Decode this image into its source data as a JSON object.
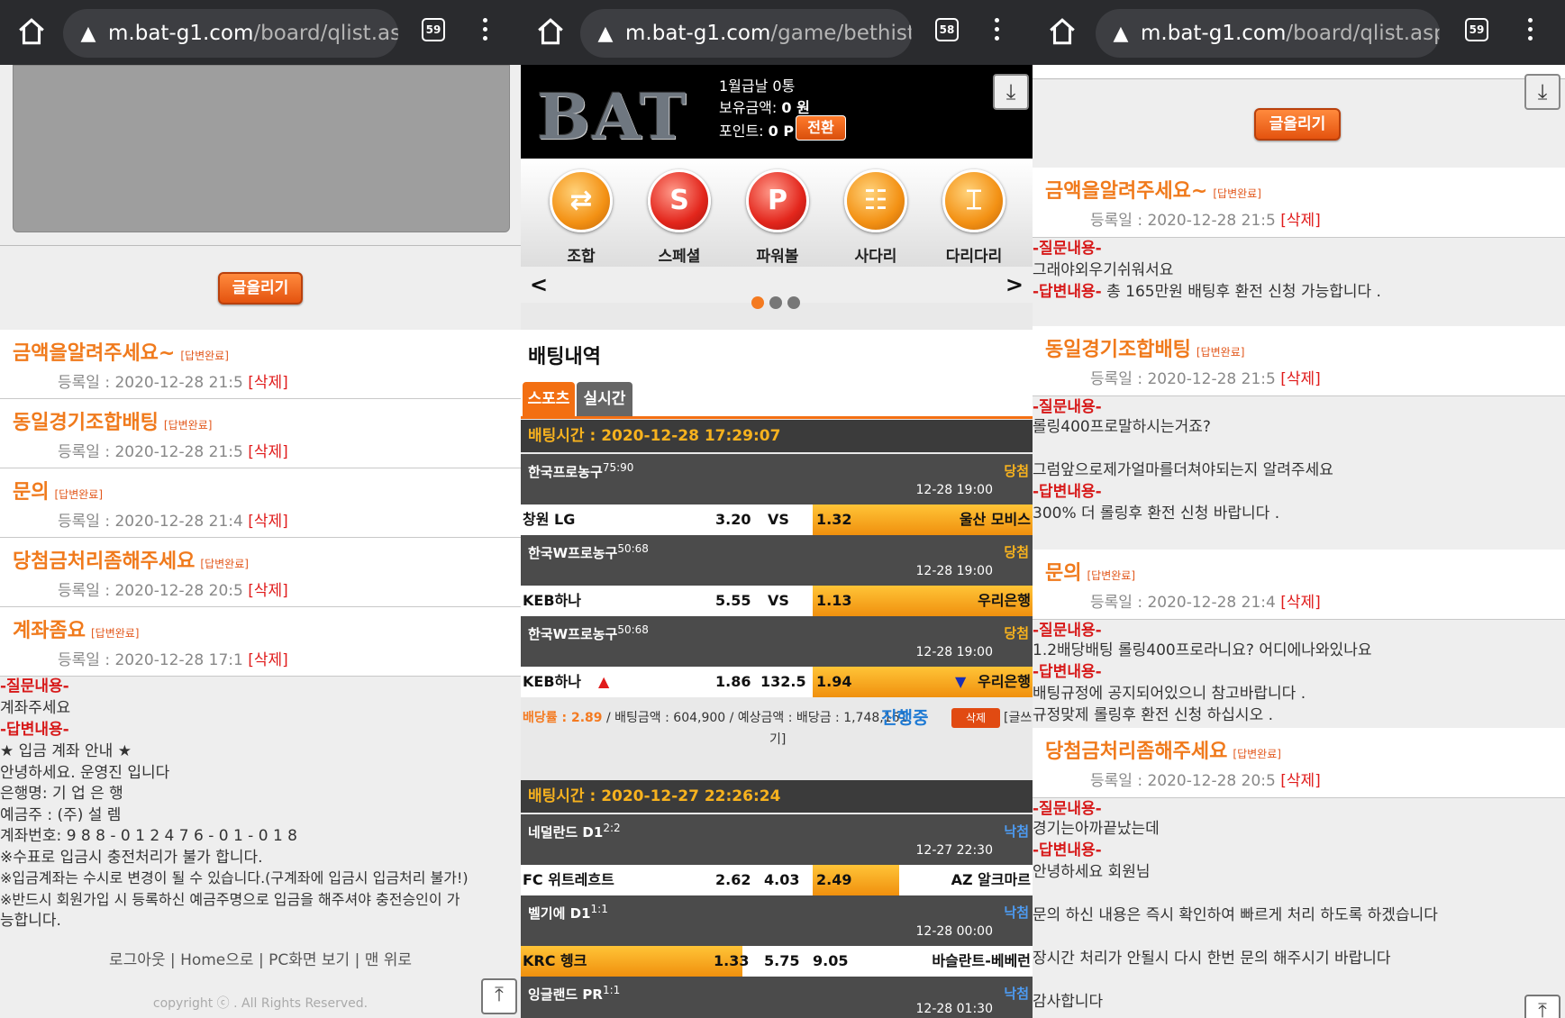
{
  "panel1": {
    "url_domain": "m.bat-g1.com",
    "url_path": "/board/qlist.asp",
    "tab_count": "59",
    "write_button": "글올리기",
    "items": [
      {
        "title": "금액을알려주세요~",
        "badge": "[답변완료]",
        "date": "등록일 : 2020-12-28 21:5",
        "del": "[삭제]"
      },
      {
        "title": "동일경기조합배팅",
        "badge": "[답변완료]",
        "date": "등록일 : 2020-12-28 21:5",
        "del": "[삭제]"
      },
      {
        "title": "문의",
        "badge": "[답변완료]",
        "date": "등록일 : 2020-12-28 21:4",
        "del": "[삭제]"
      },
      {
        "title": "당첨금처리좀해주세요",
        "badge": "[답변완료]",
        "date": "등록일 : 2020-12-28 20:5",
        "del": "[삭제]"
      },
      {
        "title": "계좌좀요",
        "badge": "[답변완료]",
        "date": "등록일 : 2020-12-28 17:1",
        "del": "[삭제]"
      }
    ],
    "q_label": "-질문내용-",
    "q_text": "계좌주세요",
    "a_label": "-답변내용-",
    "a_lines": [
      "★ 입금 계좌 안내 ★",
      "안녕하세요. 운영진 입니다",
      "은행명:   기 업 은 행",
      "예금주 :  (주) 설 렘",
      "계좌번호: 9 8 8 - 0 1 2 4 7 6 - 0 1 - 0 1 8",
      "※수표로 입금시 충전처리가 불가 합니다.",
      "※입금계좌는 수시로 변경이 될 수 있습니다.(구계좌에 입금시 입금처리 불가!)",
      "※반드시 회원가입 시 등록하신 예금주명으로 입금을 해주셔야 충전승인이 가",
      "능합니다."
    ],
    "footer_links": "로그아웃 | Home으로 | PC화면 보기 | 맨 위로",
    "copyright": "copyright ⓒ . All Rights Reserved."
  },
  "panel2": {
    "url_domain": "m.bat-g1.com",
    "url_path": "/game/bethistor",
    "tab_count": "58",
    "logo": "BAT",
    "info_line1": "1월급날 0통",
    "info_line2_label": "보유금액:",
    "info_line2_value": "0 원",
    "info_line3_label": "포인트:",
    "info_line3_value": "0 P",
    "convert_button": "전환",
    "games": [
      "조합",
      "스페셜",
      "파워볼",
      "사다리",
      "다리다리"
    ],
    "game_icons": [
      "shuffle-icon",
      "S",
      "P",
      "ladder-icon",
      "bridge-icon"
    ],
    "section_title": "배팅내역",
    "tab_sports": "스포츠",
    "tab_live": "실시간",
    "bet1": {
      "time": "배팅시간 : 2020-12-28 17:29:07",
      "matches": [
        {
          "league": "한국프로농구",
          "score": "75:90",
          "result": "당첨",
          "time": "12-28 19:00",
          "home": "창원 LG",
          "h_odds": "3.20",
          "mid": "VS",
          "a_odds": "1.32",
          "away": "울산 모비스"
        },
        {
          "league": "한국W프로농구",
          "score": "50:68",
          "result": "당첨",
          "time": "12-28 19:00",
          "home": "KEB하나",
          "h_odds": "5.55",
          "mid": "VS",
          "a_odds": "1.13",
          "away": "우리은행"
        },
        {
          "league": "한국W프로농구",
          "score": "50:68",
          "result": "당첨",
          "time": "12-28 19:00",
          "home": "KEB하나",
          "h_odds": "1.86",
          "mid": "132.5",
          "a_odds": "1.94",
          "away": "우리은행"
        }
      ],
      "summary_rate": "배당률 : 2.89",
      "summary_rest": " / 배팅금액 : 604,900 / 예상금액 : 배당금 : 1,748,161",
      "summary_tail": "기]",
      "status": "진행중",
      "delete": "삭제",
      "trail": "[글쓰"
    },
    "bet2": {
      "time": "배팅시간 : 2020-12-27 22:26:24",
      "matches": [
        {
          "league": "네덜란드 D1",
          "score": "2:2",
          "result": "낙첨",
          "time": "12-27 22:30",
          "home": "FC 위트레흐트",
          "h_odds": "2.62",
          "mid": "4.03",
          "a_odds": "2.49",
          "away": "AZ 알크마르"
        },
        {
          "league": "벨기에 D1",
          "score": "1:1",
          "result": "낙첨",
          "time": "12-28 00:00",
          "home": "KRC 헹크",
          "h_odds": "1.33",
          "mid": "5.75",
          "a_odds": "9.05",
          "away": "바슬란트-베베런"
        },
        {
          "league": "잉글랜드 PR",
          "score": "1:1",
          "result": "낙첨",
          "time": "12-28 01:30"
        }
      ]
    }
  },
  "panel3": {
    "url_domain": "m.bat-g1.com",
    "url_path": "/board/qlist.asp",
    "tab_count": "59",
    "write_button": "글올리기",
    "q_label": "-질문내용-",
    "a_label": "-답변내용-",
    "items": [
      {
        "title": "금액을알려주세요~",
        "badge": "[답변완료]",
        "date": "등록일 : 2020-12-28 21:5",
        "del": "[삭제]",
        "q": [
          "그래야외우기쉬워서요"
        ],
        "a": [
          "총 165만원 배팅후 환전 신청 가능합니다 ."
        ]
      },
      {
        "title": "동일경기조합배팅",
        "badge": "[답변완료]",
        "date": "등록일 : 2020-12-28 21:5",
        "del": "[삭제]",
        "q": [
          "롤링400프로말하시는거죠?",
          "그럼앞으로제가얼마를더쳐야되는지 알려주세요"
        ],
        "a": [
          "300% 더 롤링후 환전 신청 바랍니다 ."
        ]
      },
      {
        "title": "문의",
        "badge": "[답변완료]",
        "date": "등록일 : 2020-12-28 21:4",
        "del": "[삭제]",
        "q": [
          "1.2배당배팅 롤링400프로라니요? 어디에나와있나요"
        ],
        "a": [
          "배팅규정에 공지되어있으니 참고바랍니다 .",
          "규정맞제 롤링후 환전 신청 하십시오 ."
        ]
      },
      {
        "title": "당첨금처리좀해주세요",
        "badge": "[답변완료]",
        "date": "등록일 : 2020-12-28 20:5",
        "del": "[삭제]",
        "q": [
          "경기는아까끝났는데"
        ],
        "a": [
          "안녕하세요 회원님",
          "문의 하신 내용은 즉시 확인하여 빠르게 처리 하도록 하겠습니다",
          "장시간 처리가 안될시 다시 한번 문의 해주시기 바랍니다",
          "감사합니다"
        ]
      }
    ]
  }
}
